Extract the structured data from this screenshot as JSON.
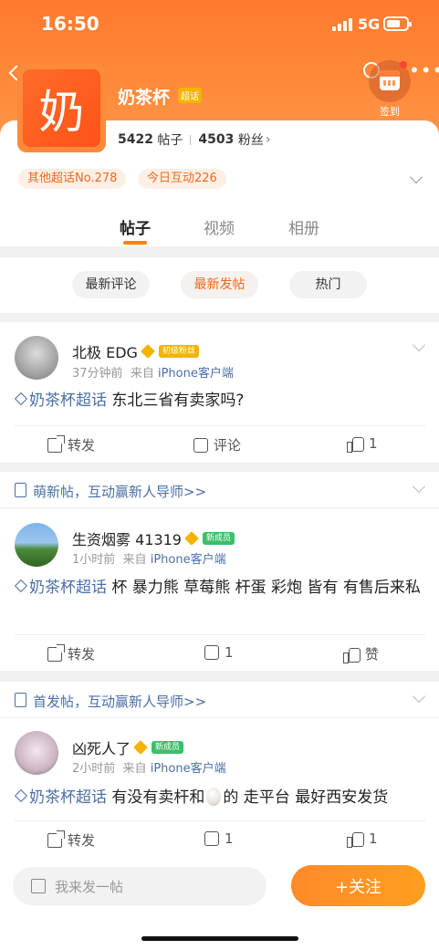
{
  "status": {
    "time": "16:50",
    "network": "5G"
  },
  "nav": {
    "back_label": "返回",
    "signin_label": "签到"
  },
  "topic": {
    "logo_char": "奶",
    "name": "奶茶杯",
    "tag": "超话",
    "posts_count": "5422",
    "posts_label": "帖子",
    "fans_count": "4503",
    "fans_label": "粉丝",
    "chips": [
      "其他超话No.278",
      "今日互动226"
    ]
  },
  "tabs": [
    "帖子",
    "视频",
    "相册"
  ],
  "filters": [
    "最新评论",
    "最新发帖",
    "热门"
  ],
  "posts": [
    {
      "user": "北极 EDG",
      "badge": "初级粉丝",
      "time": "37分钟前",
      "from": "来自",
      "source": "iPhone客户端",
      "topic": "奶茶杯超话",
      "text": "东北三省有卖家吗?",
      "share": "转发",
      "comment": "评论",
      "like": "1"
    },
    {
      "banner": "萌新帖，互动赢新人导师>>",
      "user": "生资烟雾 41319",
      "badge": "新成员",
      "time": "1小时前",
      "from": "来自",
      "source": "iPhone客户端",
      "topic": "奶茶杯超话",
      "text": "杯 暴力熊 草莓熊 杆蛋  彩炮 皆有 有售后来私",
      "share": "转发",
      "comment": "1",
      "like": "赞"
    },
    {
      "banner": "首发帖，互动赢新人导师>>",
      "user": "凶死人了",
      "badge": "新成员",
      "time": "2小时前",
      "from": "来自",
      "source": "iPhone客户端",
      "topic": "奶茶杯超话",
      "text_before": "有没有卖杆和",
      "text_after": "的 走平台 最好西安发货",
      "share": "转发",
      "comment": "1",
      "like": "1"
    }
  ],
  "bottom": {
    "compose_placeholder": "我来发一帖",
    "follow_label": "+关注"
  },
  "colors": {
    "accent": "#ff8200",
    "link": "#4a6fa5",
    "header": "#ff7a2e"
  }
}
